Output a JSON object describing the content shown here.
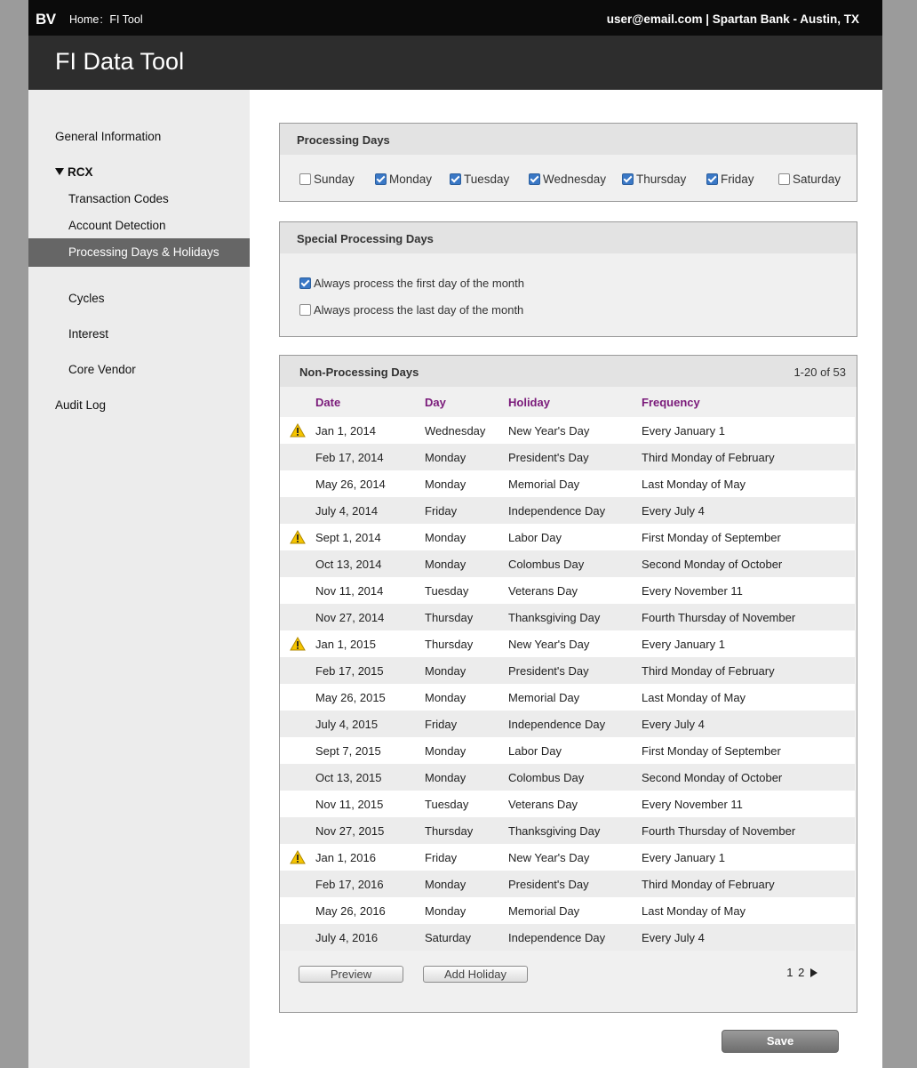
{
  "header": {
    "brand": "BV",
    "breadcrumb": {
      "home": "Home",
      "separator": ":",
      "current": "FI Tool"
    },
    "user_info": "user@email.com | Spartan Bank - Austin, TX"
  },
  "app_title": "FI Data Tool",
  "sidebar": {
    "general": "General Information",
    "group": "RCX",
    "sub_items": [
      "Transaction Codes",
      "Account Detection",
      "Processing Days & Holidays",
      "Cycles",
      "Interest",
      "Core Vendor"
    ],
    "active_item": "Processing Days & Holidays",
    "audit": "Audit Log"
  },
  "processing_days": {
    "title": "Processing Days",
    "days": [
      {
        "label": "Sunday",
        "checked": false
      },
      {
        "label": "Monday",
        "checked": true
      },
      {
        "label": "Tuesday",
        "checked": true
      },
      {
        "label": "Wednesday",
        "checked": true
      },
      {
        "label": "Thursday",
        "checked": true
      },
      {
        "label": "Friday",
        "checked": true
      },
      {
        "label": "Saturday",
        "checked": false
      }
    ]
  },
  "special_days": {
    "title": "Special Processing Days",
    "options": [
      {
        "label": "Always process the first day of the month",
        "checked": true
      },
      {
        "label": "Always process the last day of the month",
        "checked": false
      }
    ]
  },
  "non_processing": {
    "title": "Non-Processing Days",
    "count": "1-20 of 53",
    "columns": [
      "Date",
      "Day",
      "Holiday",
      "Frequency"
    ],
    "rows": [
      {
        "warn": true,
        "date": "Jan 1, 2014",
        "day": "Wednesday",
        "holiday": "New Year's Day",
        "frequency": "Every January 1"
      },
      {
        "warn": false,
        "date": "Feb 17, 2014",
        "day": "Monday",
        "holiday": "President's Day",
        "frequency": "Third Monday of February"
      },
      {
        "warn": false,
        "date": "May 26, 2014",
        "day": "Monday",
        "holiday": "Memorial Day",
        "frequency": "Last Monday of May"
      },
      {
        "warn": false,
        "date": "July 4, 2014",
        "day": "Friday",
        "holiday": "Independence Day",
        "frequency": "Every July 4"
      },
      {
        "warn": true,
        "date": "Sept 1, 2014",
        "day": "Monday",
        "holiday": "Labor Day",
        "frequency": "First Monday of September"
      },
      {
        "warn": false,
        "date": "Oct 13, 2014",
        "day": "Monday",
        "holiday": "Colombus Day",
        "frequency": "Second Monday of October"
      },
      {
        "warn": false,
        "date": "Nov 11, 2014",
        "day": "Tuesday",
        "holiday": "Veterans Day",
        "frequency": "Every November 11"
      },
      {
        "warn": false,
        "date": "Nov 27, 2014",
        "day": "Thursday",
        "holiday": "Thanksgiving Day",
        "frequency": "Fourth Thursday of November"
      },
      {
        "warn": true,
        "date": "Jan 1, 2015",
        "day": "Thursday",
        "holiday": "New Year's Day",
        "frequency": "Every January 1"
      },
      {
        "warn": false,
        "date": "Feb 17, 2015",
        "day": "Monday",
        "holiday": "President's Day",
        "frequency": "Third Monday of February"
      },
      {
        "warn": false,
        "date": "May 26, 2015",
        "day": "Monday",
        "holiday": "Memorial Day",
        "frequency": "Last Monday of May"
      },
      {
        "warn": false,
        "date": "July 4, 2015",
        "day": "Friday",
        "holiday": "Independence Day",
        "frequency": "Every July 4"
      },
      {
        "warn": false,
        "date": "Sept 7, 2015",
        "day": "Monday",
        "holiday": "Labor Day",
        "frequency": "First Monday of September"
      },
      {
        "warn": false,
        "date": "Oct 13, 2015",
        "day": "Monday",
        "holiday": "Colombus Day",
        "frequency": "Second Monday of October"
      },
      {
        "warn": false,
        "date": "Nov 11, 2015",
        "day": "Tuesday",
        "holiday": "Veterans Day",
        "frequency": "Every November 11"
      },
      {
        "warn": false,
        "date": "Nov 27, 2015",
        "day": "Thursday",
        "holiday": "Thanksgiving Day",
        "frequency": "Fourth Thursday of November"
      },
      {
        "warn": true,
        "date": "Jan 1, 2016",
        "day": "Friday",
        "holiday": "New Year's Day",
        "frequency": "Every January 1"
      },
      {
        "warn": false,
        "date": "Feb 17, 2016",
        "day": "Monday",
        "holiday": "President's Day",
        "frequency": "Third Monday of February"
      },
      {
        "warn": false,
        "date": "May 26, 2016",
        "day": "Monday",
        "holiday": "Memorial Day",
        "frequency": "Last Monday of May"
      },
      {
        "warn": false,
        "date": "July 4, 2016",
        "day": "Saturday",
        "holiday": "Independence Day",
        "frequency": "Every July 4"
      }
    ],
    "preview_label": "Preview",
    "add_label": "Add Holiday",
    "pages": [
      "1",
      "2"
    ],
    "warning_icon": "warning-icon",
    "next_icon": "next-page-icon"
  },
  "save_label": "Save",
  "colors": {
    "header_bg": "#0b0b0b",
    "title_bg": "#2d2d2d",
    "column_header": "#7a1a7a",
    "active_nav": "#666666",
    "checkbox_on": "#3a78c6",
    "warning": "#f5c400"
  }
}
